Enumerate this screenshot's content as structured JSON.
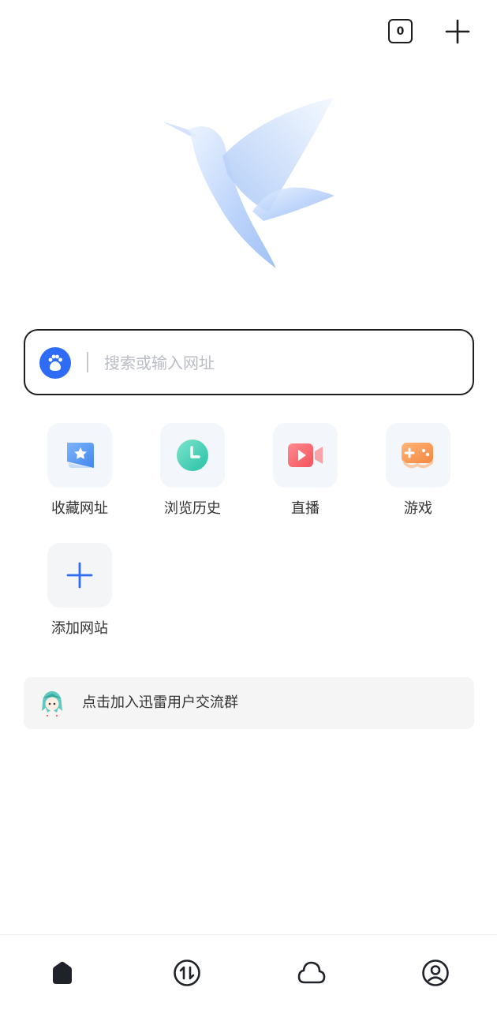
{
  "topbar": {
    "tab_count": "0",
    "icons": [
      "tabs-counter-icon",
      "plus-icon"
    ]
  },
  "logo": {
    "icon": "hummingbird-logo"
  },
  "search": {
    "engine_icon": "baidu-paw-icon",
    "placeholder": "搜索或输入网址",
    "border_color": "#1f1f1f"
  },
  "shortcuts": [
    {
      "label": "收藏网址",
      "icon": "bookmark-star-icon",
      "color": "#4a90f0"
    },
    {
      "label": "浏览历史",
      "icon": "clock-history-icon",
      "color": "#3ccfb4"
    },
    {
      "label": "直播",
      "icon": "video-camera-icon",
      "color": "#f4606b"
    },
    {
      "label": "游戏",
      "icon": "gamepad-icon",
      "color": "#f6934a"
    },
    {
      "label": "添加网站",
      "icon": "add-icon",
      "color": "#2f6cf6"
    }
  ],
  "banner": {
    "text": "点击加入迅雷用户交流群",
    "avatar_icon": "anime-avatar-icon"
  },
  "bottom_nav": [
    {
      "name": "home",
      "icon": "home-icon",
      "active": true
    },
    {
      "name": "transfer",
      "icon": "transfer-arrows-icon",
      "active": false
    },
    {
      "name": "cloud",
      "icon": "cloud-icon",
      "active": false
    },
    {
      "name": "profile",
      "icon": "user-profile-icon",
      "active": false
    }
  ],
  "colors": {
    "accent": "#2f6cf6",
    "text": "#333333",
    "placeholder": "#b9bcc2",
    "tile_bg": "#f3f6fa"
  }
}
